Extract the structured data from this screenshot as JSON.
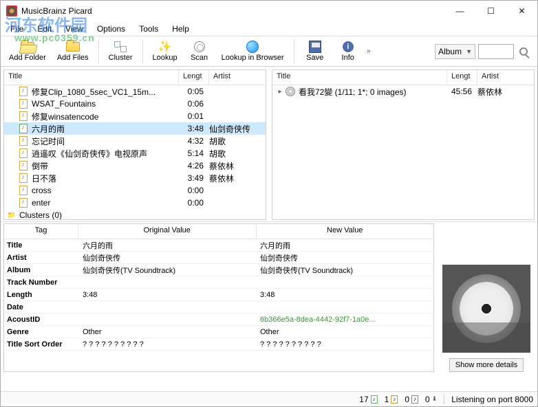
{
  "window": {
    "title": "MusicBrainz Picard",
    "min": "—",
    "max": "☐",
    "close": "✕"
  },
  "watermark": {
    "text": "河东软件园",
    "url": "www.pc0359.cn"
  },
  "menu": {
    "file": "File",
    "edit": "Edit",
    "view": "View",
    "options": "Options",
    "tools": "Tools",
    "help": "Help"
  },
  "toolbar": {
    "addFolder": "Add Folder",
    "addFiles": "Add Files",
    "cluster": "Cluster",
    "lookup": "Lookup",
    "scan": "Scan",
    "lookupBrowser": "Lookup in Browser",
    "save": "Save",
    "info": "Info"
  },
  "search": {
    "selector": "Album",
    "value": ""
  },
  "columns": {
    "title": "Title",
    "length": "Lengt",
    "artist": "Artist"
  },
  "leftPane": {
    "rows": [
      {
        "title": "修复Clip_1080_5sec_VC1_15m...",
        "len": "0:05",
        "art": ""
      },
      {
        "title": "WSAT_Fountains",
        "len": "0:06",
        "art": ""
      },
      {
        "title": "修复winsatencode",
        "len": "0:01",
        "art": ""
      },
      {
        "title": "六月的雨",
        "len": "3:48",
        "art": "仙剑奇侠传",
        "selected": true
      },
      {
        "title": "忘记时间",
        "len": "4:32",
        "art": "胡歌"
      },
      {
        "title": "逍遥叹《仙剑奇侠传》电视原声",
        "len": "5:14",
        "art": "胡歌"
      },
      {
        "title": "倒带",
        "len": "4:26",
        "art": "蔡依林"
      },
      {
        "title": "日不落",
        "len": "3:49",
        "art": "蔡依林"
      },
      {
        "title": "cross",
        "len": "0:00",
        "art": ""
      },
      {
        "title": "enter",
        "len": "0:00",
        "art": ""
      }
    ],
    "clusters": "Clusters (0)"
  },
  "rightPane": {
    "row": {
      "title": "看我72變 (1/11; 1*; 0 images)",
      "len": "45:56",
      "art": "蔡依林"
    }
  },
  "tags": {
    "head": {
      "tag": "Tag",
      "ov": "Original Value",
      "nv": "New Value"
    },
    "rows": [
      {
        "k": "Title",
        "ov": "六月的雨",
        "nv": "六月的雨"
      },
      {
        "k": "Artist",
        "ov": "仙剑奇侠传",
        "nv": "仙剑奇侠传"
      },
      {
        "k": "Album",
        "ov": "仙剑奇侠传(TV Soundtrack)",
        "nv": "仙剑奇侠传(TV Soundtrack)"
      },
      {
        "k": "Track Number",
        "ov": "",
        "nv": ""
      },
      {
        "k": "Length",
        "ov": "3:48",
        "nv": "3:48"
      },
      {
        "k": "Date",
        "ov": "",
        "nv": ""
      },
      {
        "k": "AcoustID",
        "ov": "",
        "nv": "6b366e5a-8dea-4442-92f7-1a0e...",
        "green": true
      },
      {
        "k": "Genre",
        "ov": "Other",
        "nv": "Other"
      },
      {
        "k": "Title Sort Order",
        "ov": "? ? ? ? ? ? ? ? ? ?",
        "nv": "? ? ? ? ? ? ? ? ? ?"
      }
    ],
    "moreBtn": "Show more details"
  },
  "statusbar": {
    "counts": {
      "a": "17",
      "b": "1",
      "c": "0",
      "d": "0"
    },
    "listening": "Listening on port 8000"
  }
}
